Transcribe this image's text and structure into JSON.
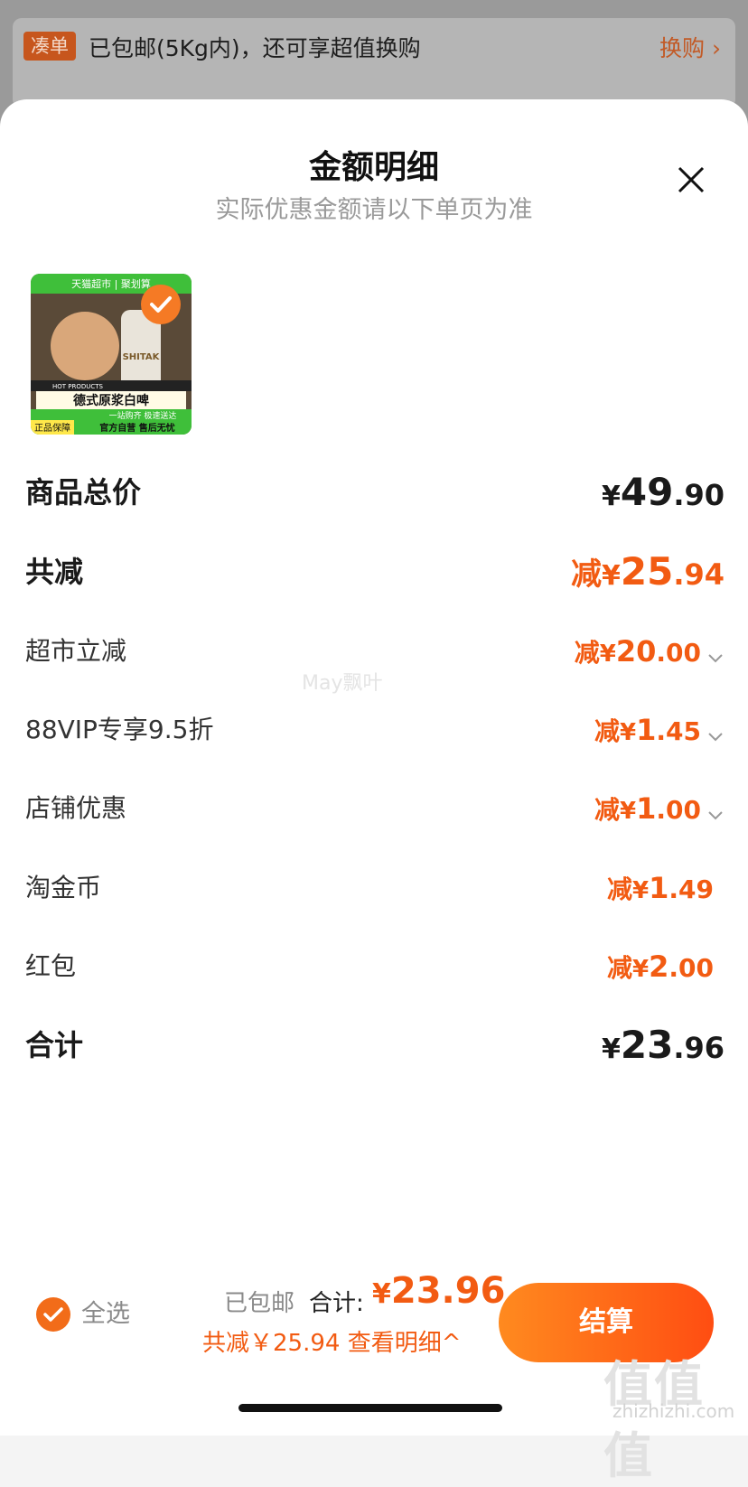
{
  "promo": {
    "tag": "凑单",
    "text": "已包邮(5Kg内)，还可享超值换购",
    "link": "换购 ›"
  },
  "sheet": {
    "title": "金额明细",
    "subtitle": "实际优惠金额请以下单页为准"
  },
  "product": {
    "badge_top": "天猫超市 | 聚划算",
    "brand": "SHITAK",
    "line1": "德式原浆白啤",
    "line2": "一站购齐 极速送达",
    "line3": "官方自营 售后无忧",
    "guarantee": "正品保障",
    "hot": "HOT PRODUCTS"
  },
  "rows": {
    "goods_total": {
      "label": "商品总价",
      "currency": "¥",
      "int": "49",
      "dec": ".90"
    },
    "total_reduce": {
      "label": "共减",
      "prefix": "减",
      "currency": "¥",
      "int": "25",
      "dec": ".94"
    },
    "market": {
      "label": "超市立减",
      "prefix": "减",
      "currency": "¥",
      "int": "20",
      "dec": ".00"
    },
    "vip": {
      "label": "88VIP专享9.5折",
      "prefix": "减",
      "currency": "¥",
      "int": "1",
      "dec": ".45"
    },
    "store": {
      "label": "店铺优惠",
      "prefix": "减",
      "currency": "¥",
      "int": "1",
      "dec": ".00"
    },
    "coins": {
      "label": "淘金币",
      "prefix": "减",
      "currency": "¥",
      "int": "1",
      "dec": ".49"
    },
    "redpacket": {
      "label": "红包",
      "prefix": "减",
      "currency": "¥",
      "int": "2",
      "dec": ".00"
    },
    "sum": {
      "label": "合计",
      "currency": "¥",
      "int": "23",
      "dec": ".96"
    }
  },
  "watermark": "May飘叶",
  "footer": {
    "select_all": "全选",
    "shipping": "已包邮",
    "total_label": "合计:",
    "total_currency": "¥",
    "total_value": "23.96",
    "saved": "共减￥25.94",
    "detail": "查看明细^",
    "checkout": "结算"
  },
  "brand_watermark": {
    "logo": "值值值",
    "site": "zhizhizhi.com"
  },
  "colors": {
    "accent": "#f25b12",
    "checkout_start": "#ff8a1f",
    "checkout_end": "#ff4d12"
  }
}
